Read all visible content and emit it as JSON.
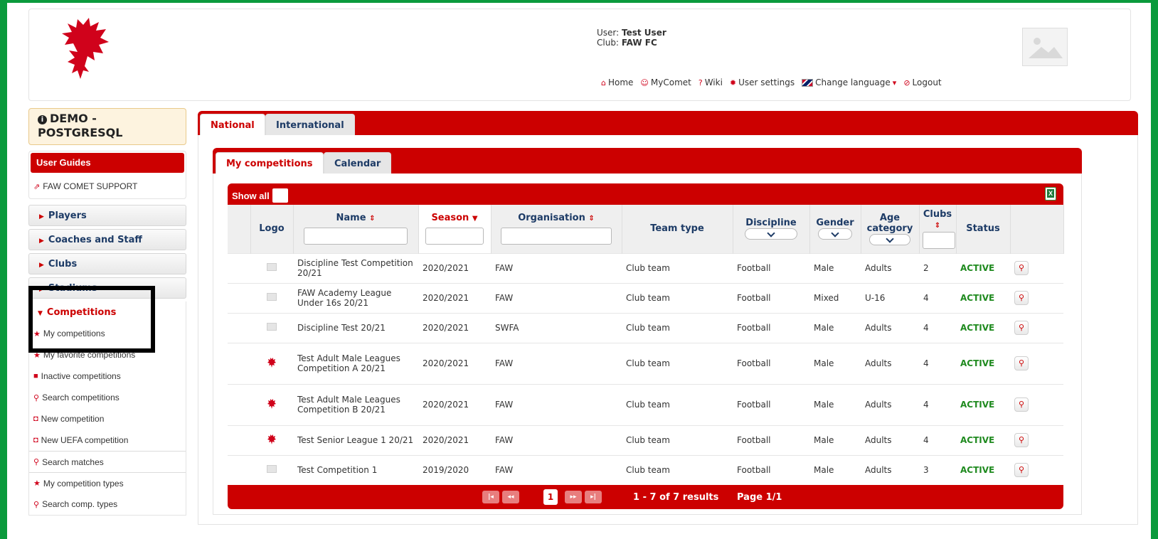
{
  "header": {
    "user_label": "User:",
    "user_name": "Test User",
    "club_label": "Club:",
    "club_name": "FAW FC",
    "nav": [
      {
        "label": "Home",
        "icon": "home-icon"
      },
      {
        "label": "MyComet",
        "icon": "user-icon"
      },
      {
        "label": "Wiki",
        "icon": "question-icon"
      },
      {
        "label": "User settings",
        "icon": "gear-icon"
      },
      {
        "label": "Change language",
        "icon": "uk-flag-icon"
      },
      {
        "label": "Logout",
        "icon": "logout-icon"
      }
    ]
  },
  "sidebar": {
    "env_line1": "DEMO -",
    "env_line2": "POSTGRESQL",
    "guides_title": "User Guides",
    "support_link": "FAW COMET SUPPORT",
    "menu": [
      "Players",
      "Coaches and Staff",
      "Clubs",
      "Stadiums"
    ],
    "competitions_title": "Competitions",
    "items": [
      "My competitions",
      "My favorite competitions",
      "Inactive competitions",
      "Search competitions",
      "New competition",
      "New UEFA competition",
      "Search matches",
      "My competition types",
      "Search comp. types"
    ]
  },
  "tabs": {
    "national": "National",
    "international": "International"
  },
  "subtabs": {
    "mine": "My competitions",
    "calendar": "Calendar"
  },
  "grid": {
    "show_all": "Show all",
    "columns": {
      "logo": "Logo",
      "name": "Name",
      "season": "Season",
      "organisation": "Organisation",
      "team_type": "Team type",
      "discipline": "Discipline",
      "gender": "Gender",
      "age_line1": "Age",
      "age_line2": "category",
      "clubs": "Clubs",
      "status": "Status"
    },
    "rows": [
      {
        "name": "Discipline Test Competition 20/21",
        "season": "2020/2021",
        "org": "FAW",
        "team_type": "Club team",
        "discipline": "Football",
        "gender": "Male",
        "age": "Adults",
        "clubs": "2",
        "status": "ACTIVE",
        "logo": "placeholder"
      },
      {
        "name": "FAW Academy League Under 16s 20/21",
        "season": "2020/2021",
        "org": "FAW",
        "team_type": "Club team",
        "discipline": "Football",
        "gender": "Mixed",
        "age": "U-16",
        "clubs": "4",
        "status": "ACTIVE",
        "logo": "placeholder"
      },
      {
        "name": "Discipline Test 20/21",
        "season": "2020/2021",
        "org": "SWFA",
        "team_type": "Club team",
        "discipline": "Football",
        "gender": "Male",
        "age": "Adults",
        "clubs": "4",
        "status": "ACTIVE",
        "logo": "placeholder"
      },
      {
        "name": "Test Adult Male Leagues Competition A 20/21",
        "season": "2020/2021",
        "org": "FAW",
        "team_type": "Club team",
        "discipline": "Football",
        "gender": "Male",
        "age": "Adults",
        "clubs": "4",
        "status": "ACTIVE",
        "logo": "dragon"
      },
      {
        "name": "Test Adult Male Leagues Competition B 20/21",
        "season": "2020/2021",
        "org": "FAW",
        "team_type": "Club team",
        "discipline": "Football",
        "gender": "Male",
        "age": "Adults",
        "clubs": "4",
        "status": "ACTIVE",
        "logo": "dragon"
      },
      {
        "name": "Test Senior League 1 20/21",
        "season": "2020/2021",
        "org": "FAW",
        "team_type": "Club team",
        "discipline": "Football",
        "gender": "Male",
        "age": "Adults",
        "clubs": "4",
        "status": "ACTIVE",
        "logo": "dragon"
      },
      {
        "name": "Test Competition 1",
        "season": "2019/2020",
        "org": "FAW",
        "team_type": "Club team",
        "discipline": "Football",
        "gender": "Male",
        "age": "Adults",
        "clubs": "3",
        "status": "ACTIVE",
        "logo": "placeholder"
      }
    ],
    "pager": {
      "current": "1",
      "results": "1 - 7 of 7 results",
      "page": "Page 1/1"
    }
  },
  "colors": {
    "brand_red": "#cc0000",
    "frame_green": "#0a9a3c",
    "active_green": "#1f8a1f",
    "nav_blue": "#1d3b66"
  }
}
